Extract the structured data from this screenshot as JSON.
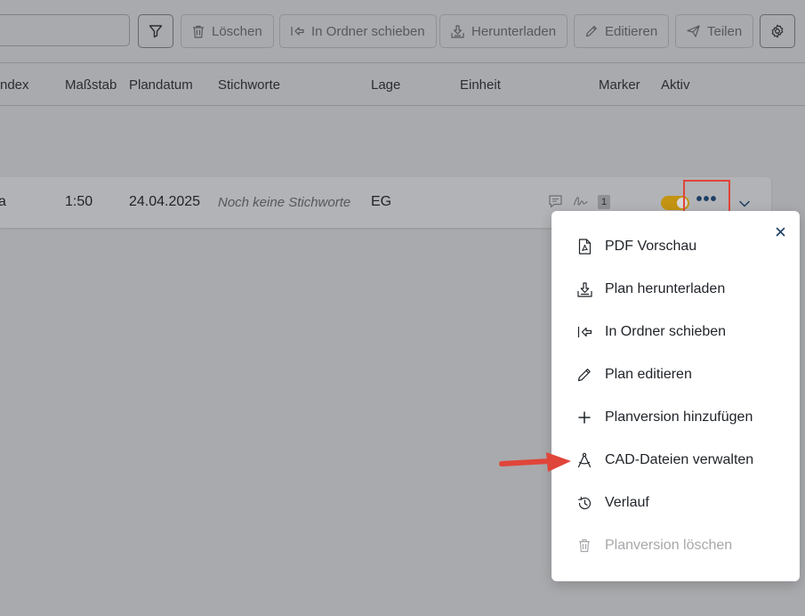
{
  "toolbar": {
    "search_placeholder": "",
    "buttons": {
      "delete": "Löschen",
      "move": "In Ordner schieben",
      "download": "Herunterladen",
      "edit": "Editieren",
      "share": "Teilen"
    }
  },
  "table": {
    "headers": {
      "index": "ndex",
      "scale": "Maßstab",
      "plan_date": "Plandatum",
      "keywords": "Stichworte",
      "location": "Lage",
      "unit": "Einheit",
      "marker": "Marker",
      "active": "Aktiv"
    },
    "row": {
      "index_fragment": "a",
      "scale": "1:50",
      "plan_date": "24.04.2025",
      "keywords": "Noch keine Stichworte",
      "location": "EG",
      "marker_count": "1",
      "more": "•••",
      "active": true
    }
  },
  "menu": {
    "items": [
      {
        "label": "PDF Vorschau",
        "icon": "pdf-icon"
      },
      {
        "label": "Plan herunterladen",
        "icon": "download-icon"
      },
      {
        "label": "In Ordner schieben",
        "icon": "move-folder-icon"
      },
      {
        "label": "Plan editieren",
        "icon": "pencil-icon"
      },
      {
        "label": "Planversion hinzufügen",
        "icon": "plus-icon"
      },
      {
        "label": "CAD-Dateien verwalten",
        "icon": "compass-icon"
      },
      {
        "label": "Verlauf",
        "icon": "history-icon"
      },
      {
        "label": "Planversion löschen",
        "icon": "trash-icon",
        "disabled": true
      }
    ]
  },
  "colors": {
    "overlay_background": "#a9aaad",
    "accent_navy": "#1c3f64",
    "toggle_on": "#c39412",
    "highlight_red": "#e0453a"
  }
}
